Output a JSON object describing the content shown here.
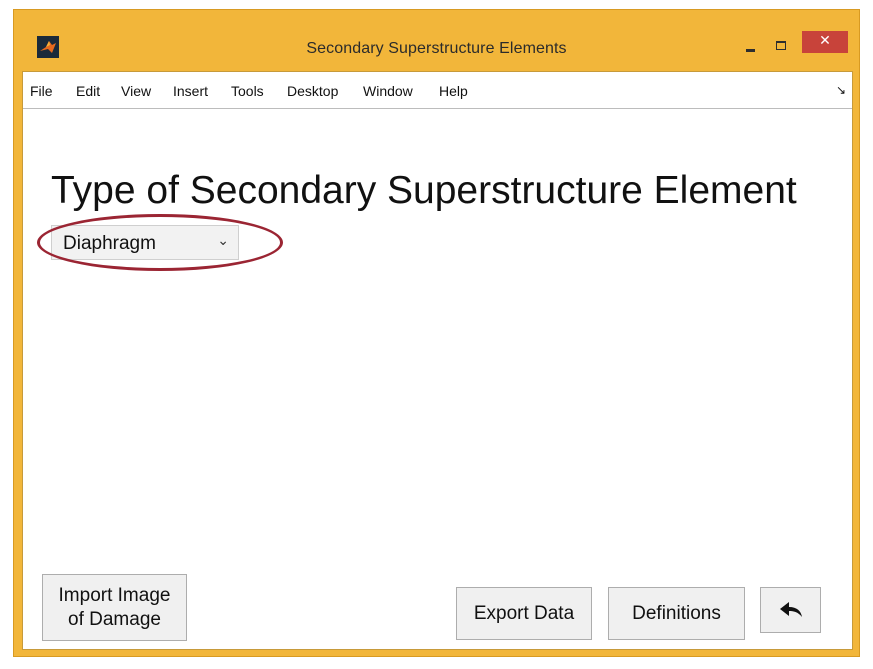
{
  "window": {
    "title": "Secondary Superstructure Elements",
    "close_glyph": "✕",
    "frame_color": "#f2b63a",
    "close_color": "#c8433a"
  },
  "menu": {
    "items": [
      "File",
      "Edit",
      "View",
      "Insert",
      "Tools",
      "Desktop",
      "Window",
      "Help"
    ],
    "overflow_glyph": "↘"
  },
  "main": {
    "heading": "Type of Secondary Superstructure Element",
    "element_type_select": {
      "selected_value": "Diaphragm",
      "arrow_glyph": "⌄",
      "highlight_color": "#9b2533"
    }
  },
  "buttons": {
    "import_line1": "Import Image",
    "import_line2": "of Damage",
    "export": "Export Data",
    "definitions": "Definitions",
    "back_icon": "back-arrow-icon"
  }
}
